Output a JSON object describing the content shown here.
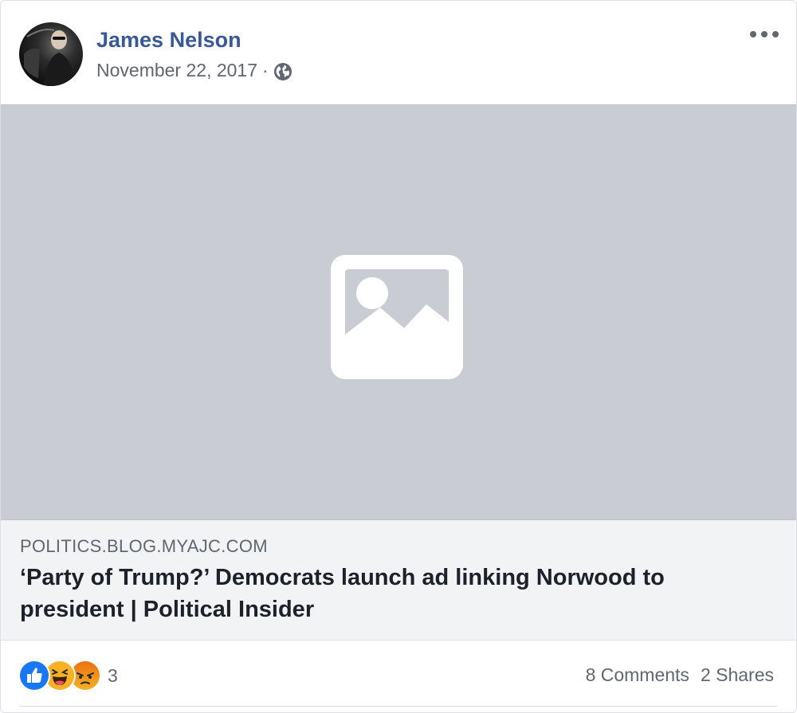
{
  "post": {
    "author": "James Nelson",
    "date": "November 22, 2017",
    "separator": "·",
    "privacy_icon": "globe-icon",
    "menu_icon": "more-options-icon"
  },
  "media": {
    "icon": "image-placeholder-icon"
  },
  "link": {
    "domain": "POLITICS.BLOG.MYAJC.COM",
    "headline": "‘Party of Trump?’ Democrats launch ad linking Norwood to president | Political Insider"
  },
  "engagement": {
    "reactions": [
      "like-reaction-icon",
      "haha-reaction-icon",
      "angry-reaction-icon"
    ],
    "reaction_count": "3",
    "comments": "8 Comments",
    "shares": "2 Shares"
  },
  "colors": {
    "author": "#385898",
    "secondary_text": "#606770",
    "media_bg": "#c9ccd3",
    "link_bg": "#f2f3f5",
    "like_blue": "#1877f2",
    "haha_yellow": "#f7b125",
    "angry_orange": "#e9710f"
  }
}
